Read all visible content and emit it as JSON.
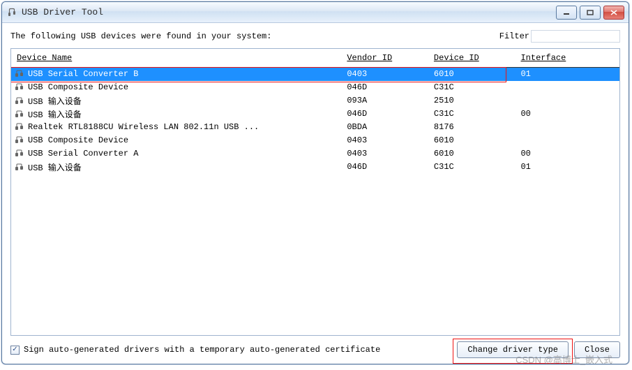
{
  "window": {
    "title": "USB Driver Tool"
  },
  "intro": "The following USB devices were found in your system:",
  "filter": {
    "label": "Filter",
    "value": ""
  },
  "columns": {
    "name": "Device Name",
    "vendor": "Vendor ID",
    "device": "Device ID",
    "iface": "Interface"
  },
  "rows": [
    {
      "name": "USB Serial Converter B",
      "vendor": "0403",
      "device": "6010",
      "iface": "01",
      "selected": true
    },
    {
      "name": "USB Composite Device",
      "vendor": "046D",
      "device": "C31C",
      "iface": ""
    },
    {
      "name": "USB 输入设备",
      "vendor": "093A",
      "device": "2510",
      "iface": ""
    },
    {
      "name": "USB 输入设备",
      "vendor": "046D",
      "device": "C31C",
      "iface": "00"
    },
    {
      "name": "Realtek RTL8188CU Wireless LAN 802.11n USB ...",
      "vendor": "0BDA",
      "device": "8176",
      "iface": ""
    },
    {
      "name": "USB Composite Device",
      "vendor": "0403",
      "device": "6010",
      "iface": ""
    },
    {
      "name": "USB Serial Converter A",
      "vendor": "0403",
      "device": "6010",
      "iface": "00"
    },
    {
      "name": "USB 输入设备",
      "vendor": "046D",
      "device": "C31C",
      "iface": "01"
    }
  ],
  "checkbox": {
    "checked": true,
    "label": "Sign auto-generated drivers with a temporary auto-generated certificate"
  },
  "buttons": {
    "change": "Change driver type",
    "close": "Close"
  },
  "watermark": "CSDN @高博士_嵌入式"
}
